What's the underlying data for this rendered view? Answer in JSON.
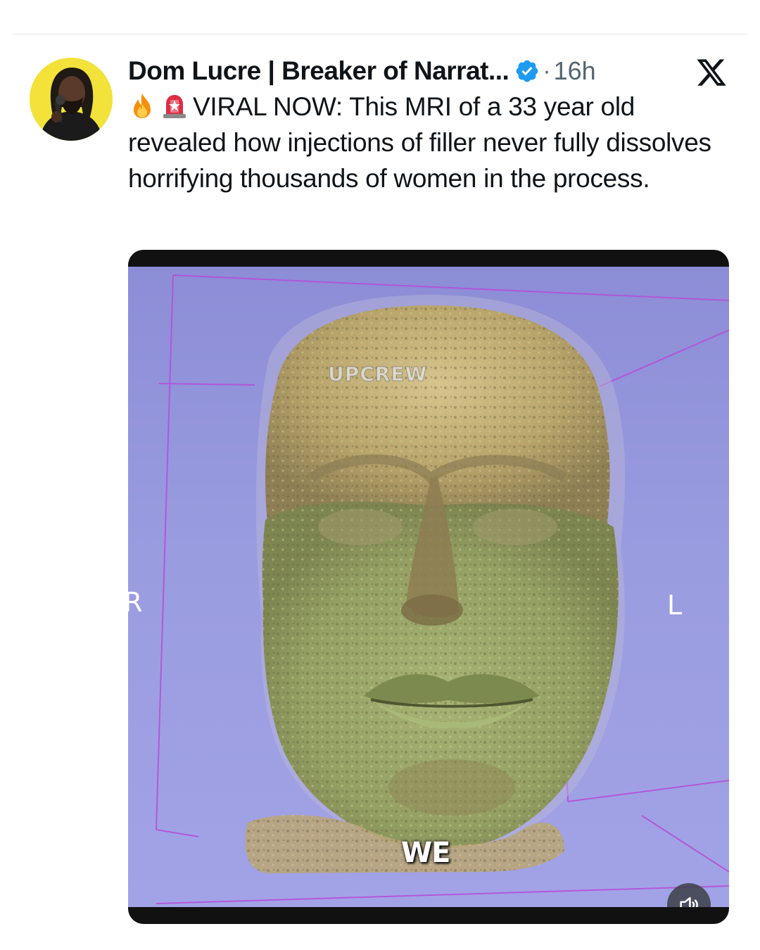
{
  "tweet": {
    "author_name": "Dom Lucre | Breaker of Narrat...",
    "separator": "·",
    "timestamp": "16h",
    "text": "VIRAL NOW: This MRI of a 33 year old revealed how injections of filler never fully dissolves horrifying thousands of women in the process.",
    "leading_emojis": [
      "fire-emoji",
      "siren-emoji"
    ],
    "verified_badge_color": "#1d9bf0",
    "platform_icon": "x-logo-icon"
  },
  "media": {
    "watermark": "UPCREW",
    "axis_left_label": "R",
    "axis_right_label": "L",
    "caption": "WE",
    "background_color": "#9a9ce0",
    "volume_icon": "speaker-icon"
  }
}
